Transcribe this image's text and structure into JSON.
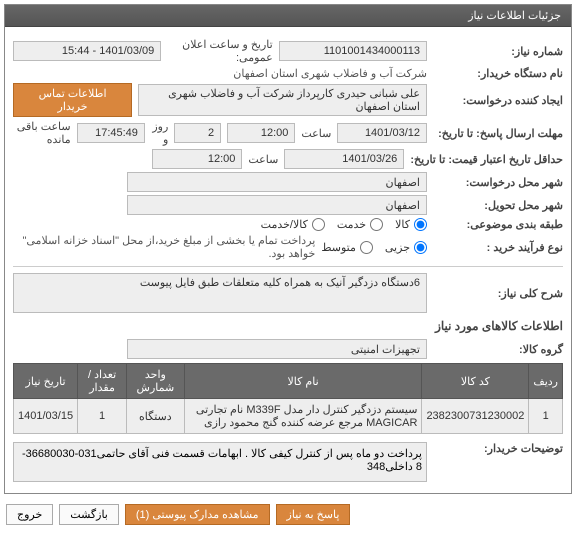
{
  "header": {
    "title": "جزئیات اطلاعات نیاز"
  },
  "labels": {
    "need_number": "شماره نیاز:",
    "buyer_org": "نام دستگاه خریدار:",
    "request_creator": "ایجاد کننده درخواست:",
    "deadline": "مهلت ارسال پاسخ: تا تاریخ:",
    "quote_until": "حداقل تاریخ اعتبار قیمت: تا تاریخ:",
    "request_city": "شهر محل درخواست:",
    "delivery_city": "شهر محل تحویل:",
    "category": "طبقه بندی موضوعی:",
    "procurement_type": "نوع فرآیند خرید :",
    "need_desc": "شرح کلی نیاز:",
    "items_info": "اطلاعات کالاهای مورد نیاز",
    "item_group": "گروه کالا:",
    "buyer_notes": "توضیحات خریدار:",
    "public_date": "تاریخ و ساعت اعلان عمومی:",
    "time_label": "ساعت",
    "day_and": "روز و",
    "remaining": "ساعت باقی مانده",
    "contact_btn": "اطلاعات تماس خریدار"
  },
  "values": {
    "need_number": "1101001434000113",
    "public_date": "1401/03/09 - 15:44",
    "buyer_org": "شرکت آب و فاضلاب شهری استان اصفهان",
    "request_creator": "علی شبانی حیدری کارپرداز شرکت آب و فاضلاب شهری استان اصفهان",
    "deadline_date": "1401/03/12",
    "deadline_time": "12:00",
    "remain_days": "2",
    "remain_time": "17:45:49",
    "quote_until_date": "1401/03/26",
    "quote_until_time": "12:00",
    "request_city": "اصفهان",
    "delivery_city": "اصفهان",
    "need_desc_text": "6دستگاه دزدگیر آنیک به همراه کلیه متعلقات طبق فایل پیوست",
    "item_group": "تجهیزات امنیتی",
    "buyer_notes_text": "پرداخت دو ماه پس از کنترل کیفی کالا . ابهامات قسمت فنی آقای حاتمی031-36680030-8 داخلی348"
  },
  "radios": {
    "category": {
      "options": [
        {
          "label": "کالا",
          "checked": true
        },
        {
          "label": "خدمت",
          "checked": false
        },
        {
          "label": "کالا/خدمت",
          "checked": false
        }
      ]
    },
    "procurement": {
      "options": [
        {
          "label": "جزیی",
          "checked": true
        },
        {
          "label": "متوسط",
          "checked": false
        }
      ],
      "note": "پرداخت تمام یا بخشی از مبلغ خرید،از محل \"اسناد خزانه اسلامی\" خواهد بود."
    }
  },
  "table": {
    "headers": [
      "ردیف",
      "کد کالا",
      "نام کالا",
      "واحد شمارش",
      "تعداد / مقدار",
      "تاریخ نیاز"
    ],
    "rows": [
      {
        "idx": "1",
        "code": "2382300731230002",
        "name": "سیستم دزدگیر کنترل دار مدل M339F نام تجارتی MAGICAR مرجع عرضه کننده گنج محمود رازی",
        "unit": "دستگاه",
        "qty": "1",
        "date": "1401/03/15"
      }
    ]
  },
  "buttons": {
    "reply": "پاسخ به نیاز",
    "attachments": "مشاهده مدارک پیوستی (1)",
    "back": "بازگشت",
    "exit": "خروج"
  }
}
